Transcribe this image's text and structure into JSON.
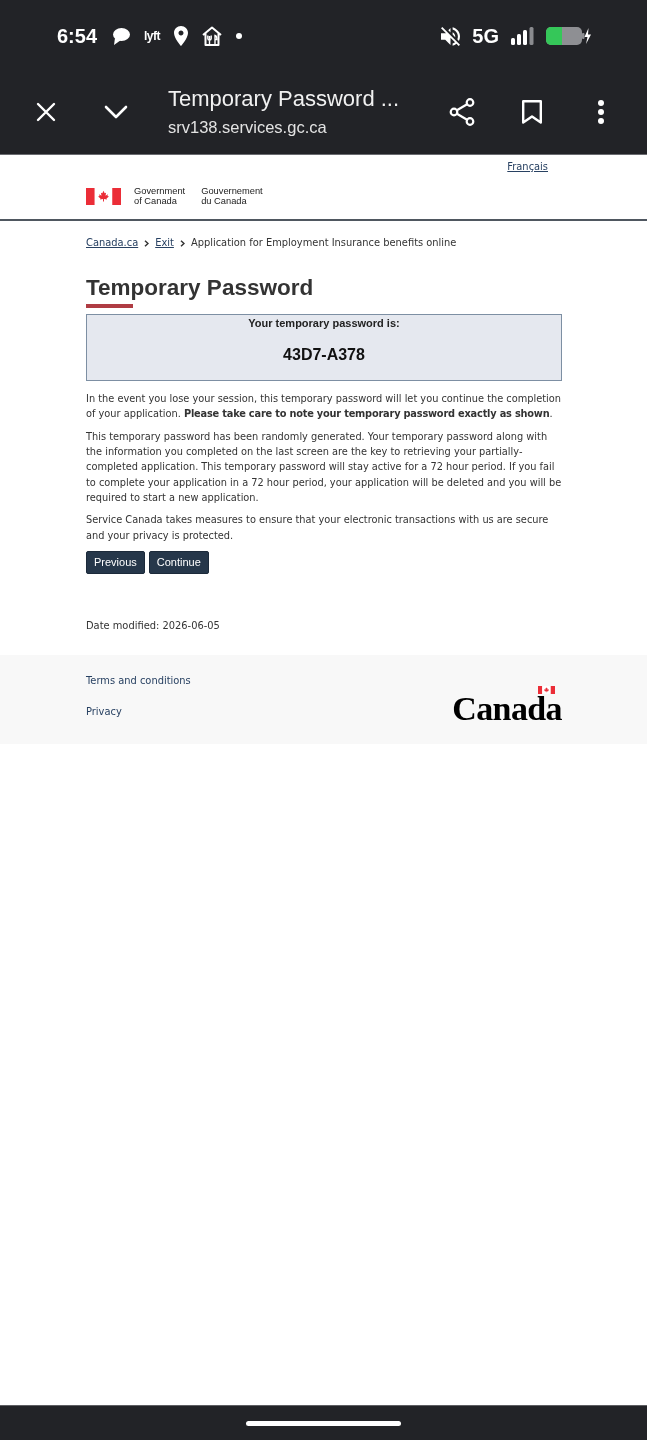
{
  "status_bar": {
    "time": "6:54",
    "app_label": "lyft",
    "network": "5G"
  },
  "browser_bar": {
    "title": "Temporary Password ...",
    "url": "srv138.services.gc.ca"
  },
  "header": {
    "language_link": "Français",
    "signature": {
      "english": [
        "Government",
        "of Canada"
      ],
      "french": [
        "Gouvernement",
        "du Canada"
      ]
    }
  },
  "breadcrumbs": [
    {
      "label": "Canada.ca",
      "kind": "link"
    },
    {
      "label": "Exit",
      "kind": "link"
    },
    {
      "label": "Application for Employment Insurance benefits online",
      "kind": "current"
    }
  ],
  "page_title": "Temporary Password",
  "password_panel": {
    "label": "Your temporary password is:",
    "password": "43D7-A378"
  },
  "paragraphs": [
    "In the event you lose your session, this temporary password will let you continue the completion of your application. **Please take care to note your temporary password exactly as shown**.",
    "This temporary password has been randomly generated. Your temporary password along with the information you completed on the last screen are the key to retrieving your partially-completed application. This temporary password will stay active for a 72 hour period. If you fail to complete your application in a 72 hour period, your application will be deleted and you will be required to start a new application.",
    "Service Canada takes measures to ensure that your electronic transactions with us are secure and your privacy is protected."
  ],
  "buttons": [
    "Previous",
    "Continue"
  ],
  "date_modified": "Date modified: 2026-06-05",
  "footer": {
    "links": [
      "Terms and conditions",
      "Privacy"
    ],
    "wordmark": "Canada"
  }
}
